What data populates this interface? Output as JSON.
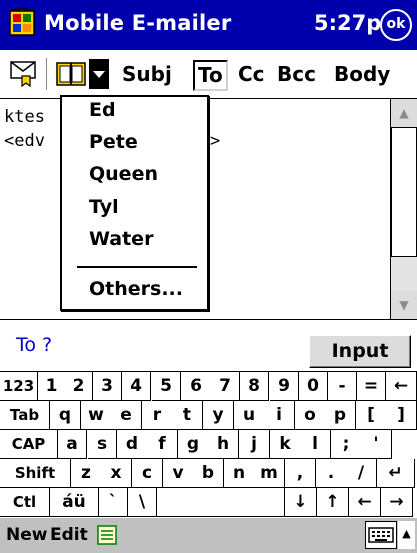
{
  "window": {
    "title": "Mobile E-mailer",
    "time": "5:27p",
    "ok_label": "ok"
  },
  "toolbar": {
    "items": [
      {
        "label": "Subj"
      },
      {
        "label": "To"
      },
      {
        "label": "Cc"
      },
      {
        "label": "Bcc"
      },
      {
        "label": "Body"
      }
    ],
    "selected": "To"
  },
  "editor": {
    "line1": "ktes",
    "line2": "<edv",
    "line2_tail": ">"
  },
  "dropdown": {
    "items": [
      {
        "label": "Ed"
      },
      {
        "label": "Pete"
      },
      {
        "label": "Queen"
      },
      {
        "label": "Tyl"
      },
      {
        "label": "Water"
      }
    ],
    "others_label": "Others..."
  },
  "status": {
    "prompt": "To ?",
    "input_label": "Input"
  },
  "keyboard": {
    "rows": [
      [
        "123",
        "1",
        "2",
        "3",
        "4",
        "5",
        "6",
        "7",
        "8",
        "9",
        "0",
        "-",
        "=",
        "←"
      ],
      [
        "Tab",
        "q",
        "w",
        "e",
        "r",
        "t",
        "y",
        "u",
        "i",
        "o",
        "p",
        "[",
        "]"
      ],
      [
        "CAP",
        "a",
        "s",
        "d",
        "f",
        "g",
        "h",
        "j",
        "k",
        "l",
        ";",
        "'"
      ],
      [
        "Shift",
        "z",
        "x",
        "c",
        "v",
        "b",
        "n",
        "m",
        ",",
        ".",
        "/",
        "↵"
      ],
      [
        "Ctl",
        "áü",
        "`",
        "\\",
        "",
        "↓",
        "↑",
        "←",
        "→"
      ]
    ]
  },
  "command_bar": {
    "new_label": "New",
    "edit_label": "Edit"
  },
  "colors": {
    "titlebar": "#0000ad",
    "prompt_text": "#0000cc",
    "command_bar": "#c0c0c0"
  }
}
